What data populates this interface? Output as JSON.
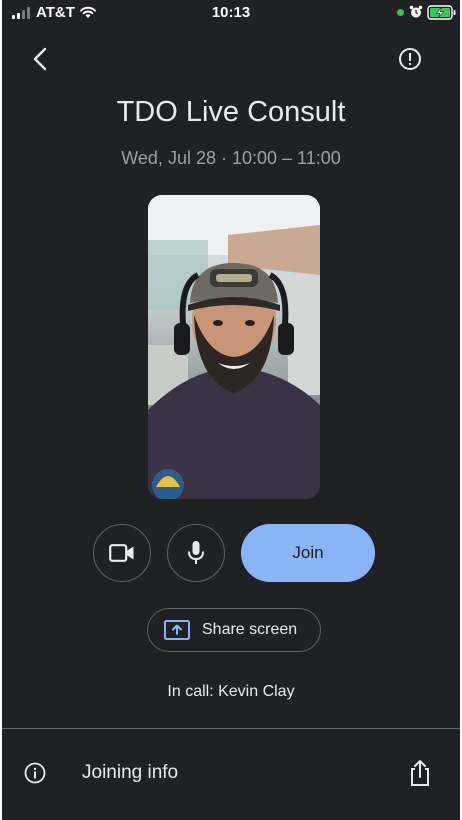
{
  "status_bar": {
    "carrier": "AT&T",
    "time": "10:13",
    "icons": [
      "signal-icon",
      "wifi-icon",
      "camera-in-use-dot",
      "alarm-icon",
      "battery-charging-icon"
    ]
  },
  "header": {
    "back_icon": "chevron-left-icon",
    "report_icon": "exclamation-circle-icon"
  },
  "meeting": {
    "title": "TDO Live Consult",
    "schedule": "Wed, Jul 28 · 10:00 – 11:00"
  },
  "controls": {
    "camera_icon": "video-camera-icon",
    "mic_icon": "microphone-icon",
    "join_label": "Join",
    "share_label": "Share screen",
    "share_icon": "present-screen-icon"
  },
  "in_call": {
    "prefix": "In call: ",
    "names": "Kevin Clay"
  },
  "footer": {
    "joining_info_label": "Joining info",
    "info_icon": "info-icon",
    "share_icon": "share-out-icon"
  },
  "colors": {
    "background": "#202124",
    "join_button": "#8ab4f8",
    "secondary_text": "#9aa0a6",
    "outline": "#5f6368"
  }
}
